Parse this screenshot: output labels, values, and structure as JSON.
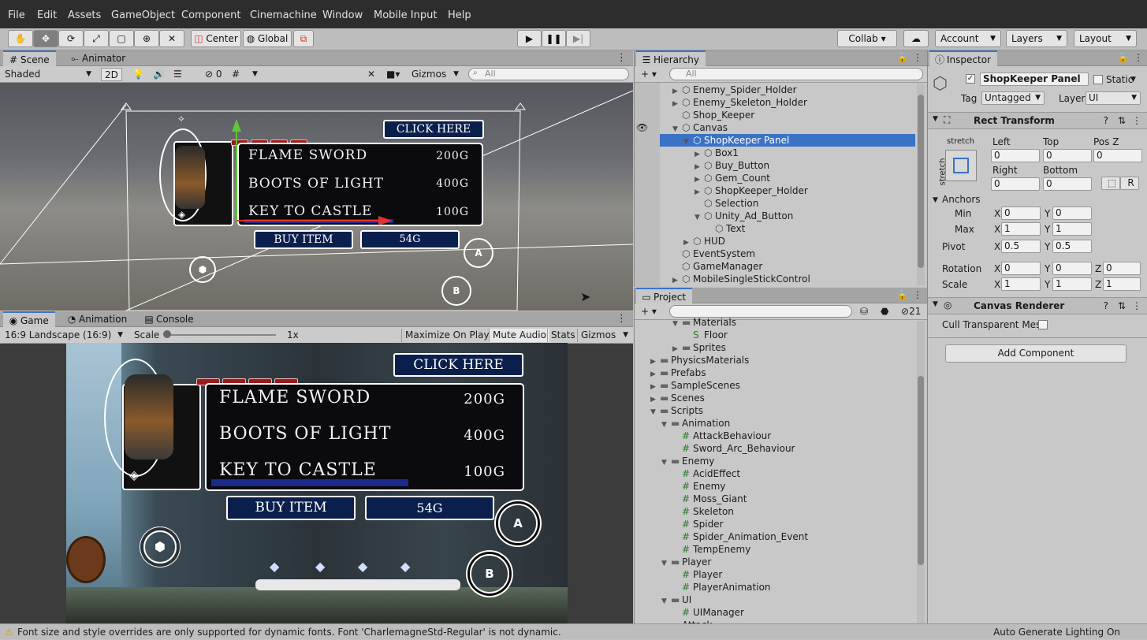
{
  "menu": [
    "File",
    "Edit",
    "Assets",
    "GameObject",
    "Component",
    "Cinemachine",
    "Window",
    "Mobile Input",
    "Help"
  ],
  "toolbar": {
    "center": "Center",
    "global": "Global",
    "collab": "Collab ▾",
    "account": "Account",
    "layers": "Layers",
    "layout": "Layout"
  },
  "scene": {
    "tab_scene": "Scene",
    "tab_animator": "Animator",
    "shading": "Shaded",
    "mode2d": "2D",
    "hidden_count": "0",
    "gizmos": "Gizmos",
    "search": "All"
  },
  "shop": {
    "click_here": "CLICK HERE",
    "items": [
      {
        "name": "FLAME SWORD",
        "price": "200G"
      },
      {
        "name": "BOOTS OF LIGHT",
        "price": "400G"
      },
      {
        "name": "KEY TO CASTLE",
        "price": "100G"
      }
    ],
    "buy": "BUY ITEM",
    "gems": "54G",
    "btn_a": "A",
    "btn_b": "B"
  },
  "game": {
    "tab_game": "Game",
    "tab_animation": "Animation",
    "tab_console": "Console",
    "aspect": "16:9 Landscape (16:9)",
    "scale_label": "Scale",
    "scale_value": "1x",
    "maximize": "Maximize On Play",
    "mute": "Mute Audio",
    "stats": "Stats",
    "gizmos": "Gizmos"
  },
  "hierarchy": {
    "title": "Hierarchy",
    "search": "All",
    "rows": [
      {
        "label": "Enemy_Spider_Holder",
        "indent": 0,
        "arrow": "▶"
      },
      {
        "label": "Enemy_Skeleton_Holder",
        "indent": 0,
        "arrow": "▶"
      },
      {
        "label": "Shop_Keeper",
        "indent": 0,
        "arrow": ""
      },
      {
        "label": "Canvas",
        "indent": 0,
        "arrow": "▼"
      },
      {
        "label": "ShopKeeper Panel",
        "indent": 1,
        "arrow": "▼"
      },
      {
        "label": "Box1",
        "indent": 2,
        "arrow": "▶"
      },
      {
        "label": "Buy_Button",
        "indent": 2,
        "arrow": "▶"
      },
      {
        "label": "Gem_Count",
        "indent": 2,
        "arrow": "▶"
      },
      {
        "label": "ShopKeeper_Holder",
        "indent": 2,
        "arrow": "▶"
      },
      {
        "label": "Selection",
        "indent": 2,
        "arrow": ""
      },
      {
        "label": "Unity_Ad_Button",
        "indent": 2,
        "arrow": "▼"
      },
      {
        "label": "Text",
        "indent": 3,
        "arrow": ""
      },
      {
        "label": "HUD",
        "indent": 1,
        "arrow": "▶"
      },
      {
        "label": "EventSystem",
        "indent": 0,
        "arrow": ""
      },
      {
        "label": "GameManager",
        "indent": 0,
        "arrow": ""
      },
      {
        "label": "MobileSingleStickControl",
        "indent": 0,
        "arrow": "▶"
      }
    ]
  },
  "project": {
    "title": "Project",
    "hidden": "21",
    "rows": [
      {
        "label": "Materials",
        "indent": 2,
        "arrow": "▼",
        "type": "folder"
      },
      {
        "label": "Floor",
        "indent": 3,
        "arrow": "",
        "type": "material"
      },
      {
        "label": "Sprites",
        "indent": 2,
        "arrow": "▶",
        "type": "folder"
      },
      {
        "label": "PhysicsMaterials",
        "indent": 0,
        "arrow": "▶",
        "type": "folder"
      },
      {
        "label": "Prefabs",
        "indent": 0,
        "arrow": "▶",
        "type": "folder"
      },
      {
        "label": "SampleScenes",
        "indent": 0,
        "arrow": "▶",
        "type": "folder"
      },
      {
        "label": "Scenes",
        "indent": 0,
        "arrow": "▶",
        "type": "folder"
      },
      {
        "label": "Scripts",
        "indent": 0,
        "arrow": "▼",
        "type": "folder"
      },
      {
        "label": "Animation",
        "indent": 1,
        "arrow": "▼",
        "type": "folder"
      },
      {
        "label": "AttackBehaviour",
        "indent": 2,
        "arrow": "",
        "type": "script"
      },
      {
        "label": "Sword_Arc_Behaviour",
        "indent": 2,
        "arrow": "",
        "type": "script"
      },
      {
        "label": "Enemy",
        "indent": 1,
        "arrow": "▼",
        "type": "folder"
      },
      {
        "label": "AcidEffect",
        "indent": 2,
        "arrow": "",
        "type": "script"
      },
      {
        "label": "Enemy",
        "indent": 2,
        "arrow": "",
        "type": "script"
      },
      {
        "label": "Moss_Giant",
        "indent": 2,
        "arrow": "",
        "type": "script"
      },
      {
        "label": "Skeleton",
        "indent": 2,
        "arrow": "",
        "type": "script"
      },
      {
        "label": "Spider",
        "indent": 2,
        "arrow": "",
        "type": "script"
      },
      {
        "label": "Spider_Animation_Event",
        "indent": 2,
        "arrow": "",
        "type": "script"
      },
      {
        "label": "TempEnemy",
        "indent": 2,
        "arrow": "",
        "type": "script"
      },
      {
        "label": "Player",
        "indent": 1,
        "arrow": "▼",
        "type": "folder"
      },
      {
        "label": "Player",
        "indent": 2,
        "arrow": "",
        "type": "script"
      },
      {
        "label": "PlayerAnimation",
        "indent": 2,
        "arrow": "",
        "type": "script"
      },
      {
        "label": "UI",
        "indent": 1,
        "arrow": "▼",
        "type": "folder"
      },
      {
        "label": "UIManager",
        "indent": 2,
        "arrow": "",
        "type": "script"
      },
      {
        "label": "Attack",
        "indent": 1,
        "arrow": "",
        "type": "folder"
      }
    ]
  },
  "inspector": {
    "title": "Inspector",
    "name": "ShopKeeper Panel",
    "static": "Static",
    "tag_label": "Tag",
    "tag": "Untagged",
    "layer_label": "Layer",
    "layer": "UI",
    "rect": "Rect Transform",
    "stretch": "stretch",
    "left": "Left",
    "top": "Top",
    "posz": "Pos Z",
    "left_v": "0",
    "top_v": "0",
    "posz_v": "0",
    "right": "Right",
    "bottom": "Bottom",
    "right_v": "0",
    "bottom_v": "0",
    "r_btn": "R",
    "anchors": "Anchors",
    "min": "Min",
    "max": "Max",
    "pivot": "Pivot",
    "rotation": "Rotation",
    "scale": "Scale",
    "min_x": "0",
    "min_y": "0",
    "max_x": "1",
    "max_y": "1",
    "pivot_x": "0.5",
    "pivot_y": "0.5",
    "rot_x": "0",
    "rot_y": "0",
    "rot_z": "0",
    "scale_x": "1",
    "scale_y": "1",
    "scale_z": "1",
    "x": "X",
    "y": "Y",
    "z": "Z",
    "canvas_renderer": "Canvas Renderer",
    "cull": "Cull Transparent Mes",
    "add_component": "Add Component"
  },
  "status": {
    "warning": "Font size and style overrides are only supported for dynamic fonts. Font 'CharlemagneStd-Regular' is not dynamic.",
    "right": "Auto Generate Lighting On"
  }
}
